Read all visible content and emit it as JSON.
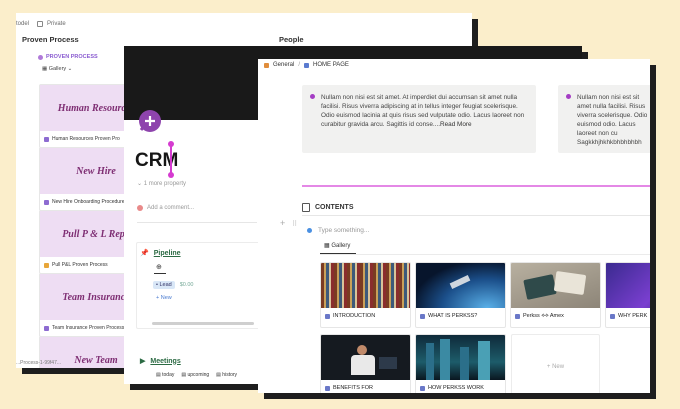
{
  "back_window": {
    "top_left_text": "todel",
    "private_label": "Private",
    "section_left": "Proven Process",
    "section_right": "People",
    "process_header": "PROVEN PROCESS",
    "gallery_label": "Gallery",
    "cards": [
      {
        "cover": "Human Resources",
        "caption": "Human Resources Proven Pro"
      },
      {
        "cover": "New Hire",
        "caption": "New Hire Onboarding Procedure"
      },
      {
        "cover": "Pull P & L Repo",
        "caption": "Pull P&L Proven Process"
      },
      {
        "cover": "Team Insurance",
        "caption": "Team Insurance Proven Process"
      },
      {
        "cover": "New Team",
        "caption": ""
      }
    ],
    "bottom_text": "...Process-1-99f47..."
  },
  "crm_window": {
    "title": "CRM",
    "more_property": "1 more property",
    "add_comment": "Add a comment...",
    "pipeline_title": "Pipeline",
    "pipeline_tab_icon": "⊕",
    "lead_tag": "Lead",
    "lead_amount": "$0.00",
    "new_label": "+ New",
    "meetings_title": "Meetings",
    "meeting_views": [
      "today",
      "upcoming",
      "history"
    ]
  },
  "home_window": {
    "breadcrumb": [
      "General",
      "HOME PAGE"
    ],
    "note1_text": "Nullam non nisi est sit amet. At imperdiet dui accumsan sit amet nulla facilisi. Risus viverra adipiscing at in tellus integer feugiat scelerisque. Odio euismod lacinia at quis risus sed vulputate odio. Lacus laoreet non curabitur gravida arcu. Sagittis id conse....",
    "note1_link": "Read More",
    "note2_text": "Nullam non nisi est sit amet nulla facilisi. Risus viverra scelerisque. Odio euismod odio. Lacus laoreet non cu Sagkkhjhkhkbhbhbhbh",
    "contents_header": "CONTENTS",
    "type_placeholder": "Type something...",
    "gallery_label": "Gallery",
    "gallery_cards": [
      {
        "label": "INTRODUCTION"
      },
      {
        "label": "WHAT IS PERKSS?"
      },
      {
        "label": "Perkss ⟡⟡ Amex"
      },
      {
        "label": "WHY PERK"
      },
      {
        "label": "BENEFITS FOR"
      },
      {
        "label": "HOW PERKSS WORK"
      }
    ],
    "new_card": "+ New"
  },
  "colors": {
    "background": "#fbeecb",
    "cover_pink": "#eeddf3",
    "cover_text": "#7e2e73",
    "accent_pink": "#e488e6",
    "crm_purple": "#8e44ad"
  },
  "icons": [
    "lock-icon",
    "pin-icon",
    "gallery-icon",
    "people-icon",
    "crm-logo-icon",
    "pipeline-icon",
    "meeting-icon",
    "home-icon",
    "page-icon",
    "doc-icon",
    "bulb-icon"
  ]
}
